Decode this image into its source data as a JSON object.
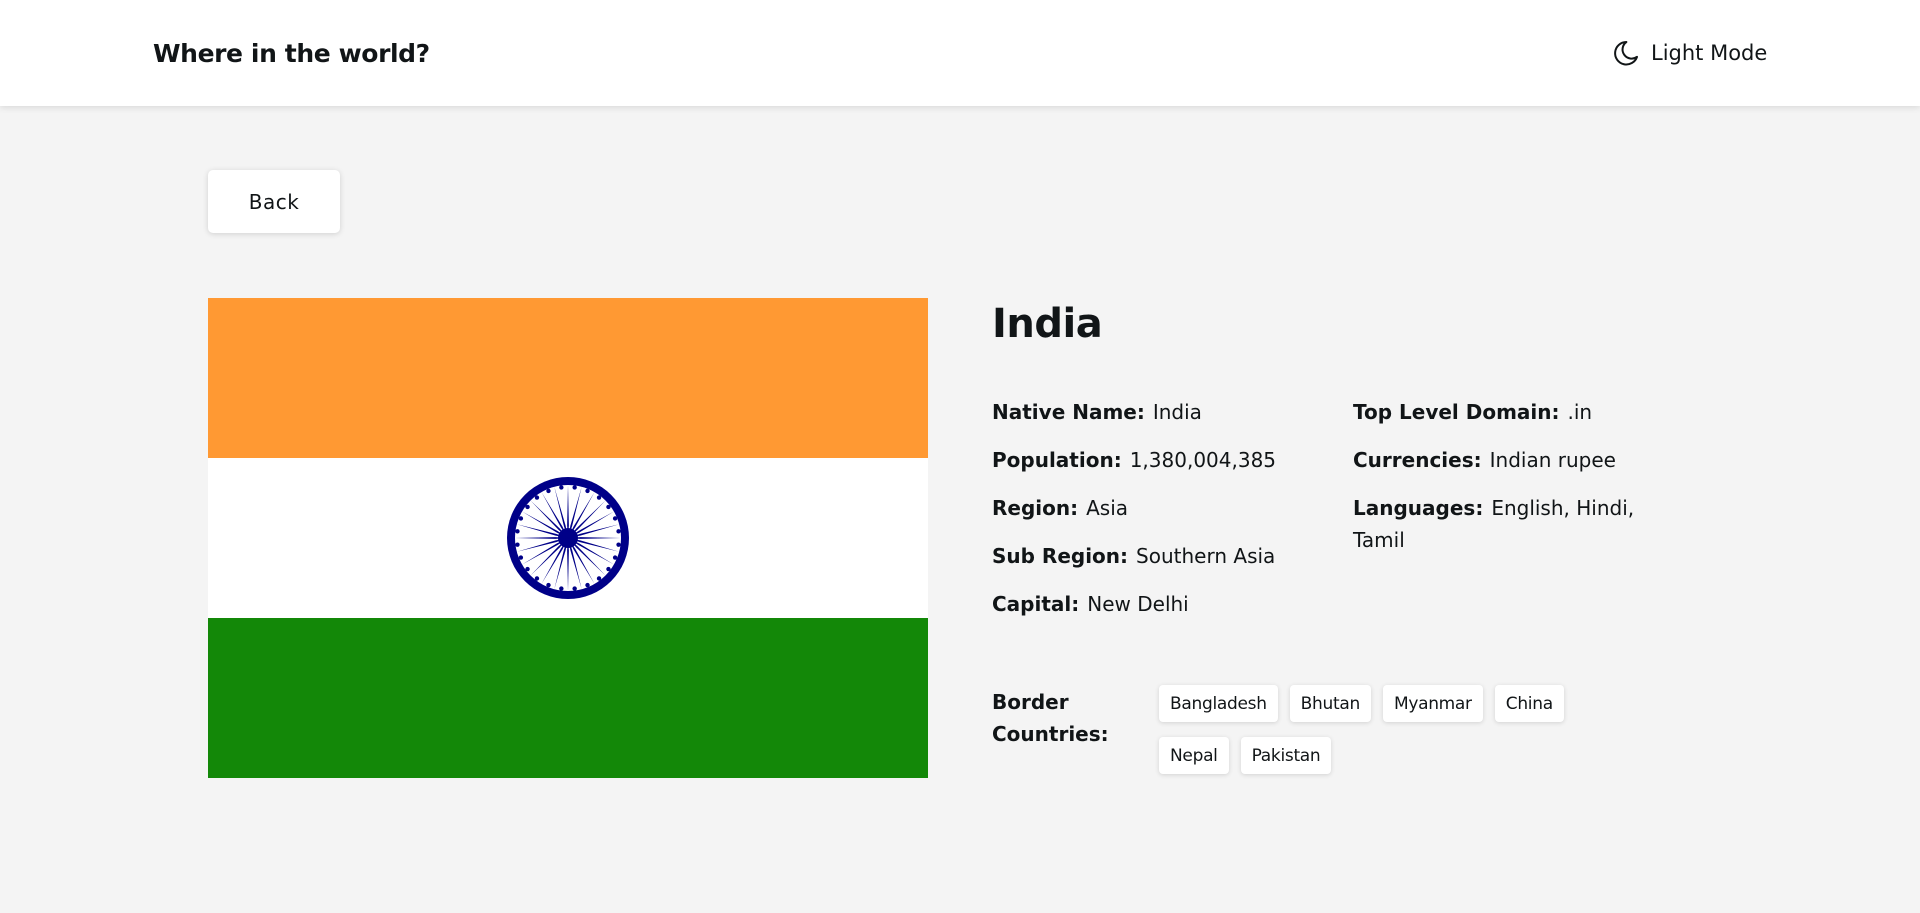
{
  "header": {
    "title": "Where in the world?",
    "mode_label": "Light Mode",
    "mode_icon": "moon-icon"
  },
  "back_button": {
    "label": "Back"
  },
  "flag": {
    "icon": "india-flag-image",
    "colors": {
      "saffron": "#FF9933",
      "white": "#FFFFFF",
      "green": "#138808",
      "chakra": "#000088"
    }
  },
  "country": {
    "name": "India",
    "details_left": [
      {
        "label": "Native Name:",
        "value": "India"
      },
      {
        "label": "Population:",
        "value": "1,380,004,385"
      },
      {
        "label": "Region:",
        "value": "Asia"
      },
      {
        "label": "Sub Region:",
        "value": "Southern Asia"
      },
      {
        "label": "Capital:",
        "value": "New Delhi"
      }
    ],
    "details_right": [
      {
        "label": "Top Level Domain:",
        "value": ".in"
      },
      {
        "label": "Currencies:",
        "value": "Indian rupee"
      },
      {
        "label": "Languages:",
        "value": "English, Hindi, Tamil"
      }
    ],
    "border_label": "Border Countries:",
    "borders": [
      "Bangladesh",
      "Bhutan",
      "Myanmar",
      "China",
      "Nepal",
      "Pakistan"
    ]
  }
}
